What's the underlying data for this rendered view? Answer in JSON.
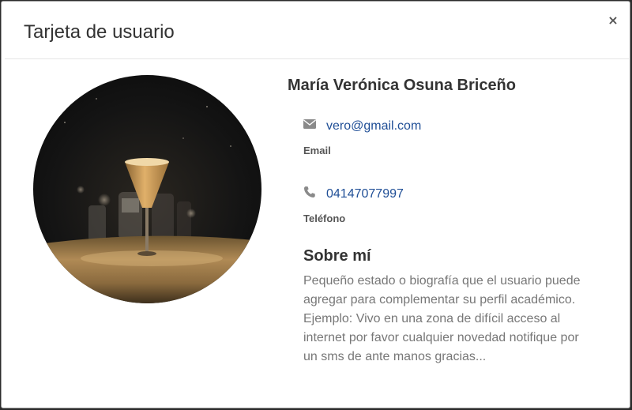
{
  "modal": {
    "title": "Tarjeta de usuario",
    "close_label": "×"
  },
  "profile": {
    "name": "María Verónica Osuna Briceño",
    "email": {
      "value": "vero@gmail.com",
      "label": "Email",
      "icon": "envelope-icon"
    },
    "phone": {
      "value": "04147077997",
      "label": "Teléfono",
      "icon": "phone-icon"
    },
    "about": {
      "title": "Sobre mí",
      "text": "Pequeño estado o biografía que el usuario puede agregar para complementar su perfil académico. Ejemplo: Vivo en una zona de difícil acceso al internet por favor cualquier novedad notifique por un sms de ante manos gracias..."
    }
  },
  "colors": {
    "link": "#1f4e96",
    "heading": "#333333",
    "muted_text": "#777777",
    "icon": "#8a8a8a"
  }
}
